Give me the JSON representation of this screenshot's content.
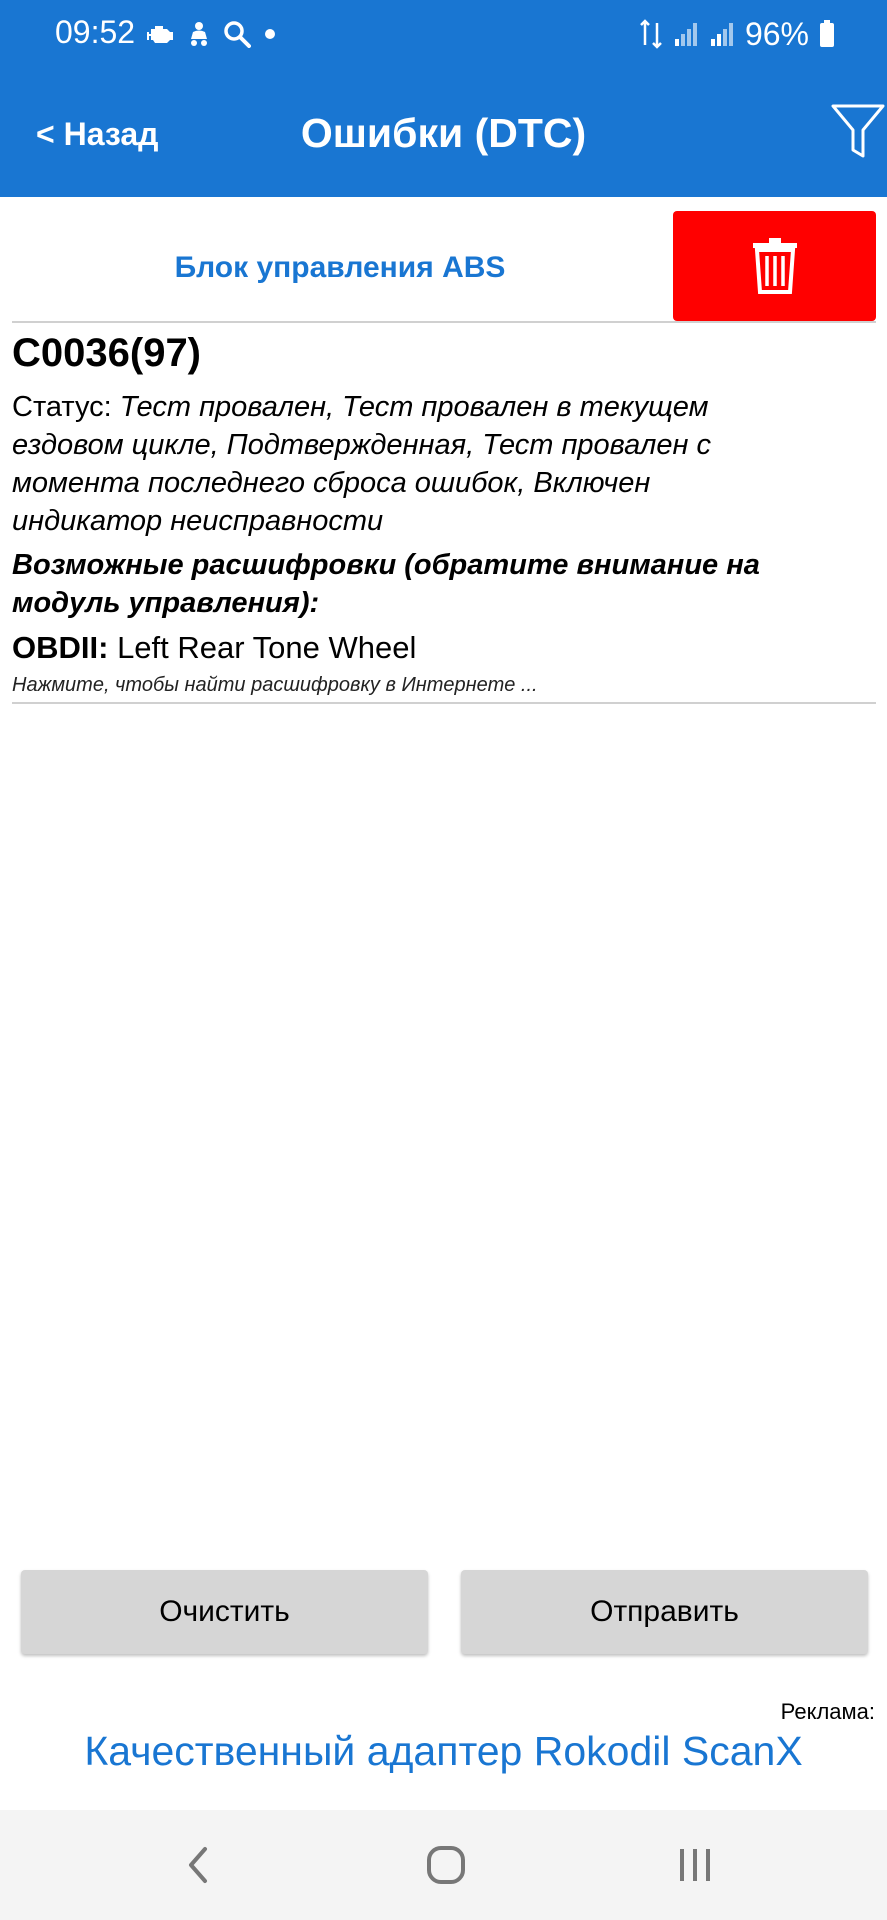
{
  "status_bar": {
    "time": "09:52",
    "battery": "96%",
    "icons": [
      "engine-icon",
      "stroller-icon",
      "search-icon",
      "dot-icon",
      "data-arrows-icon",
      "signal-icon",
      "signal-icon",
      "battery-icon"
    ]
  },
  "app_bar": {
    "back_label": "< Назад",
    "title": "Ошибки (DTC)",
    "filter_icon": "filter-icon"
  },
  "module": {
    "name": "Блок управления ABS",
    "delete_icon": "trash-icon",
    "delete_color": "#FF0000"
  },
  "dtc": {
    "code": "C0036(97)",
    "status_label": "Статус:",
    "status_value": "Тест провален, Тест провален в текущем ездовом цикле, Подтвержденная, Тест провален с момента последнего сброса ошибок, Включен индикатор неисправности",
    "hints_title": "Возможные расшифровки (обратите внимание на модуль управления):",
    "obd_label": "OBDII:",
    "obd_value": "Left Rear Tone Wheel",
    "search_hint": "Нажмите, чтобы найти расшифровку в Интернете ..."
  },
  "actions": {
    "clear_label": "Очистить",
    "send_label": "Отправить"
  },
  "ad": {
    "label": "Реклама:",
    "link_text": "Качественный адаптер Rokodil ScanX"
  },
  "nav": {
    "icons": [
      "back-icon",
      "home-icon",
      "recents-icon"
    ]
  },
  "colors": {
    "accent": "#1976D2",
    "delete": "#FF0000",
    "button_bg": "#D6D6D6"
  }
}
